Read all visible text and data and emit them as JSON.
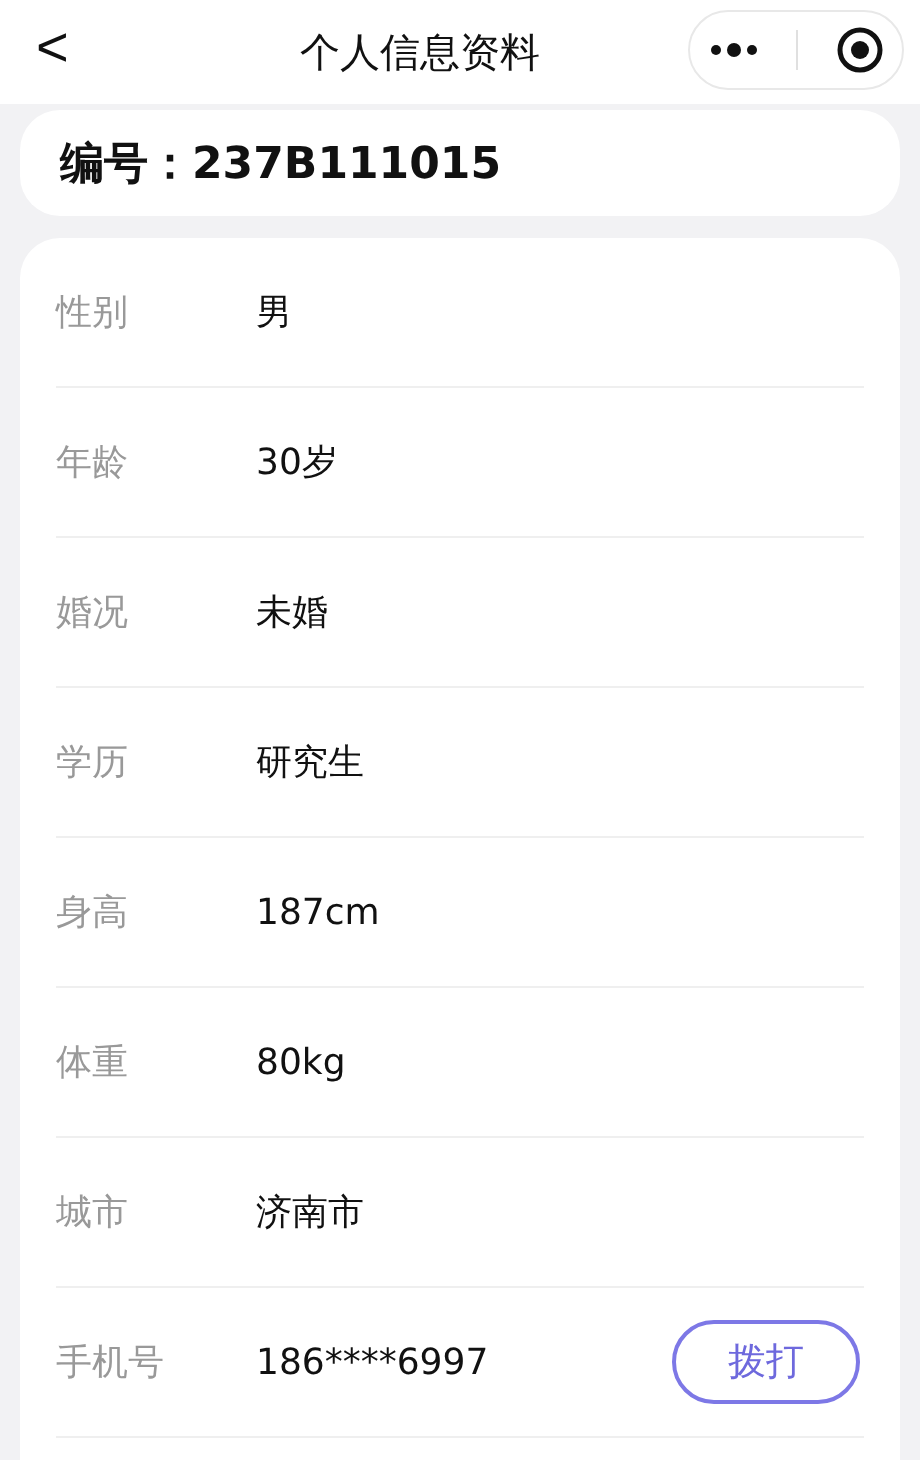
{
  "header": {
    "back": "<",
    "title": "个人信息资料"
  },
  "id_card": {
    "label": "编号：",
    "value": "237B111015"
  },
  "fields": [
    {
      "label": "性别",
      "value": "男"
    },
    {
      "label": "年龄",
      "value": "30岁"
    },
    {
      "label": "婚况",
      "value": "未婚"
    },
    {
      "label": "学历",
      "value": "研究生"
    },
    {
      "label": "身高",
      "value": "187cm"
    },
    {
      "label": "体重",
      "value": "80kg"
    },
    {
      "label": "城市",
      "value": "济南市"
    },
    {
      "label": "手机号",
      "value": "186****6997",
      "action": "拨打"
    }
  ]
}
